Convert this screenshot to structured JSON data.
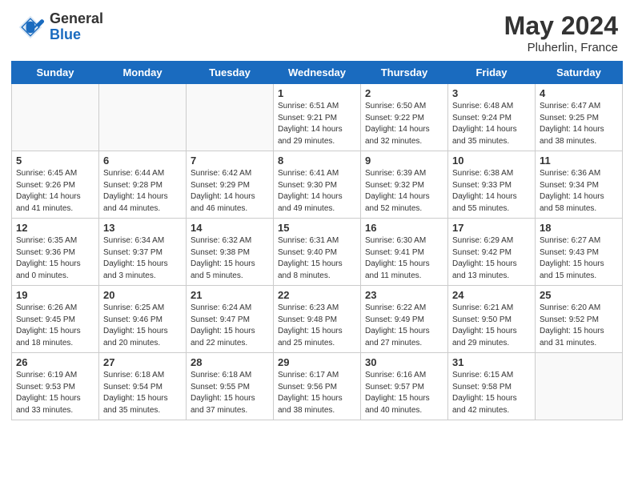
{
  "header": {
    "logo_general": "General",
    "logo_blue": "Blue",
    "title": "May 2024",
    "subtitle": "Pluherlin, France"
  },
  "days_of_week": [
    "Sunday",
    "Monday",
    "Tuesday",
    "Wednesday",
    "Thursday",
    "Friday",
    "Saturday"
  ],
  "weeks": [
    [
      {
        "num": "",
        "info": ""
      },
      {
        "num": "",
        "info": ""
      },
      {
        "num": "",
        "info": ""
      },
      {
        "num": "1",
        "info": "Sunrise: 6:51 AM\nSunset: 9:21 PM\nDaylight: 14 hours\nand 29 minutes."
      },
      {
        "num": "2",
        "info": "Sunrise: 6:50 AM\nSunset: 9:22 PM\nDaylight: 14 hours\nand 32 minutes."
      },
      {
        "num": "3",
        "info": "Sunrise: 6:48 AM\nSunset: 9:24 PM\nDaylight: 14 hours\nand 35 minutes."
      },
      {
        "num": "4",
        "info": "Sunrise: 6:47 AM\nSunset: 9:25 PM\nDaylight: 14 hours\nand 38 minutes."
      }
    ],
    [
      {
        "num": "5",
        "info": "Sunrise: 6:45 AM\nSunset: 9:26 PM\nDaylight: 14 hours\nand 41 minutes."
      },
      {
        "num": "6",
        "info": "Sunrise: 6:44 AM\nSunset: 9:28 PM\nDaylight: 14 hours\nand 44 minutes."
      },
      {
        "num": "7",
        "info": "Sunrise: 6:42 AM\nSunset: 9:29 PM\nDaylight: 14 hours\nand 46 minutes."
      },
      {
        "num": "8",
        "info": "Sunrise: 6:41 AM\nSunset: 9:30 PM\nDaylight: 14 hours\nand 49 minutes."
      },
      {
        "num": "9",
        "info": "Sunrise: 6:39 AM\nSunset: 9:32 PM\nDaylight: 14 hours\nand 52 minutes."
      },
      {
        "num": "10",
        "info": "Sunrise: 6:38 AM\nSunset: 9:33 PM\nDaylight: 14 hours\nand 55 minutes."
      },
      {
        "num": "11",
        "info": "Sunrise: 6:36 AM\nSunset: 9:34 PM\nDaylight: 14 hours\nand 58 minutes."
      }
    ],
    [
      {
        "num": "12",
        "info": "Sunrise: 6:35 AM\nSunset: 9:36 PM\nDaylight: 15 hours\nand 0 minutes."
      },
      {
        "num": "13",
        "info": "Sunrise: 6:34 AM\nSunset: 9:37 PM\nDaylight: 15 hours\nand 3 minutes."
      },
      {
        "num": "14",
        "info": "Sunrise: 6:32 AM\nSunset: 9:38 PM\nDaylight: 15 hours\nand 5 minutes."
      },
      {
        "num": "15",
        "info": "Sunrise: 6:31 AM\nSunset: 9:40 PM\nDaylight: 15 hours\nand 8 minutes."
      },
      {
        "num": "16",
        "info": "Sunrise: 6:30 AM\nSunset: 9:41 PM\nDaylight: 15 hours\nand 11 minutes."
      },
      {
        "num": "17",
        "info": "Sunrise: 6:29 AM\nSunset: 9:42 PM\nDaylight: 15 hours\nand 13 minutes."
      },
      {
        "num": "18",
        "info": "Sunrise: 6:27 AM\nSunset: 9:43 PM\nDaylight: 15 hours\nand 15 minutes."
      }
    ],
    [
      {
        "num": "19",
        "info": "Sunrise: 6:26 AM\nSunset: 9:45 PM\nDaylight: 15 hours\nand 18 minutes."
      },
      {
        "num": "20",
        "info": "Sunrise: 6:25 AM\nSunset: 9:46 PM\nDaylight: 15 hours\nand 20 minutes."
      },
      {
        "num": "21",
        "info": "Sunrise: 6:24 AM\nSunset: 9:47 PM\nDaylight: 15 hours\nand 22 minutes."
      },
      {
        "num": "22",
        "info": "Sunrise: 6:23 AM\nSunset: 9:48 PM\nDaylight: 15 hours\nand 25 minutes."
      },
      {
        "num": "23",
        "info": "Sunrise: 6:22 AM\nSunset: 9:49 PM\nDaylight: 15 hours\nand 27 minutes."
      },
      {
        "num": "24",
        "info": "Sunrise: 6:21 AM\nSunset: 9:50 PM\nDaylight: 15 hours\nand 29 minutes."
      },
      {
        "num": "25",
        "info": "Sunrise: 6:20 AM\nSunset: 9:52 PM\nDaylight: 15 hours\nand 31 minutes."
      }
    ],
    [
      {
        "num": "26",
        "info": "Sunrise: 6:19 AM\nSunset: 9:53 PM\nDaylight: 15 hours\nand 33 minutes."
      },
      {
        "num": "27",
        "info": "Sunrise: 6:18 AM\nSunset: 9:54 PM\nDaylight: 15 hours\nand 35 minutes."
      },
      {
        "num": "28",
        "info": "Sunrise: 6:18 AM\nSunset: 9:55 PM\nDaylight: 15 hours\nand 37 minutes."
      },
      {
        "num": "29",
        "info": "Sunrise: 6:17 AM\nSunset: 9:56 PM\nDaylight: 15 hours\nand 38 minutes."
      },
      {
        "num": "30",
        "info": "Sunrise: 6:16 AM\nSunset: 9:57 PM\nDaylight: 15 hours\nand 40 minutes."
      },
      {
        "num": "31",
        "info": "Sunrise: 6:15 AM\nSunset: 9:58 PM\nDaylight: 15 hours\nand 42 minutes."
      },
      {
        "num": "",
        "info": ""
      }
    ]
  ]
}
